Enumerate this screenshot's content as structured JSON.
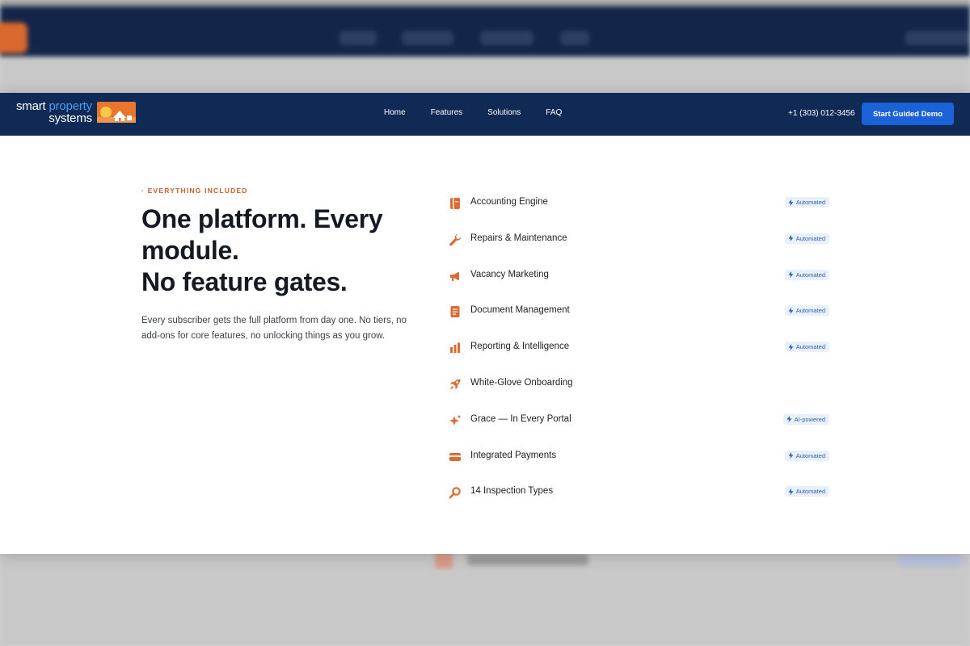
{
  "nav": {
    "logo_line1_a": "smart",
    "logo_line1_b": "property",
    "logo_line2": "systems",
    "links": [
      "Home",
      "Features",
      "Solutions",
      "FAQ"
    ],
    "phone": "+1 (303) 012-3456",
    "cta_label": "Start Guided Demo"
  },
  "hero": {
    "eyebrow": "· EVERYTHING INCLUDED",
    "title_line1": "One platform. Every",
    "title_line2": "module.",
    "title_line3": "No feature gates.",
    "description": "Every subscriber gets the full platform from day one. No tiers, no add-ons for core features, no unlocking things as you grow."
  },
  "features": [
    {
      "icon": "ledger-icon",
      "label": "Accounting Engine",
      "badge": "Automated"
    },
    {
      "icon": "wrench-icon",
      "label": "Repairs & Maintenance",
      "badge": "Automated"
    },
    {
      "icon": "megaphone-icon",
      "label": "Vacancy Marketing",
      "badge": "Automated"
    },
    {
      "icon": "document-icon",
      "label": "Document Management",
      "badge": "Automated"
    },
    {
      "icon": "bar-chart-icon",
      "label": "Reporting & Intelligence",
      "badge": "Automated"
    },
    {
      "icon": "rocket-icon",
      "label": "White-Glove Onboarding",
      "badge": ""
    },
    {
      "icon": "sparkle-icon",
      "label": "Grace — In Every Portal",
      "badge": "AI-powered"
    },
    {
      "icon": "credit-card-icon",
      "label": "Integrated Payments",
      "badge": "Automated"
    },
    {
      "icon": "magnifier-icon",
      "label": "14 Inspection Types",
      "badge": "Automated"
    }
  ],
  "colors": {
    "navy": "#0f2b55",
    "accent_orange": "#d9692f",
    "cta_blue": "#1b62d9",
    "badge_bg": "#e8f0fc",
    "badge_text": "#2f5fb0"
  }
}
